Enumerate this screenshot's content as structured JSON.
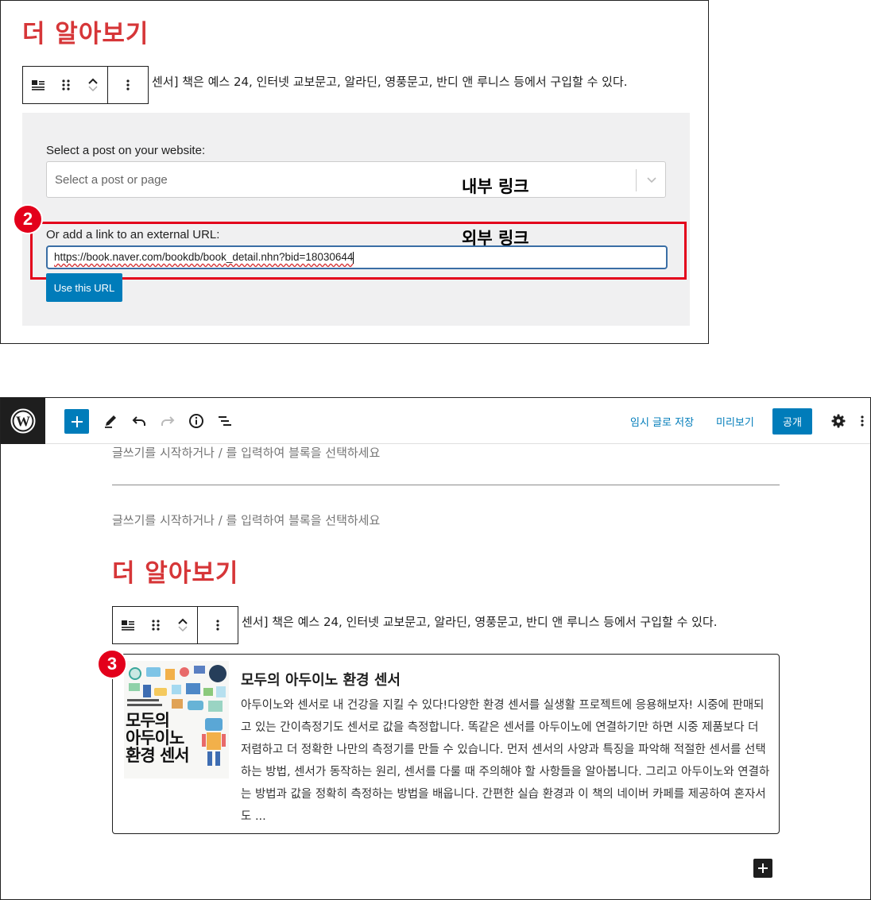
{
  "panel1": {
    "heading": "더 알아보기",
    "paragraph": "센서] 책은 예스 24, 인터넷 교보문고, 알라딘, 영풍문고, 반디 앤 루니스 등에서 구입할 수 있다.",
    "select_label": "Select a post on your website:",
    "select_placeholder": "Select a post or page",
    "internal_annotation": "내부 링크",
    "external_label": "Or add a link to an external URL:",
    "external_annotation": "외부 링크",
    "url_value": "https://book.naver.com/bookdb/book_detail.nhn?bid=18030644",
    "use_url_button": "Use this URL",
    "badge": "2"
  },
  "panel2": {
    "toolbar": {
      "save_draft": "임시 글로 저장",
      "preview": "미리보기",
      "publish": "공개"
    },
    "placeholder1": "글쓰기를 시작하거나 / 를 입력하여 블록을 선택하세요",
    "placeholder2": "글쓰기를 시작하거나 / 를 입력하여 블록을 선택하세요",
    "heading": "더 알아보기",
    "paragraph": "센서] 책은 예스 24, 인터넷 교보문고, 알라딘, 영풍문고, 반디 앤 루니스 등에서 구입할 수 있다.",
    "badge": "3",
    "card": {
      "title": "모두의 아두이노 환경 센서",
      "description": "아두이노와 센서로 내 건강을 지킬 수 있다!다양한 환경 센서를 실생활 프로젝트에 응용해보자! 시중에 판매되고 있는 간이측정기도 센서로 값을 측정합니다. 똑같은 센서를 아두이노에 연결하기만 하면 시중 제품보다 더 저렴하고 더 정확한 나만의 측정기를 만들 수 있습니다. 먼저 센서의 사양과 특징을 파악해 적절한 센서를 선택하는 방법, 센서가 동작하는 원리, 센서를 다룰 때 주의해야 할 사항들을 알아봅니다. 그리고 아두이노와 연결하는 방법과 값을 정확히 측정하는 방법을 배웁니다. 간편한 실습 환경과 이 책의 네이버 카페를 제공하여 혼자서도 ...",
      "cover_title_line1": "모두의",
      "cover_title_line2": "아두이노",
      "cover_title_line3": "환경 센서"
    }
  }
}
